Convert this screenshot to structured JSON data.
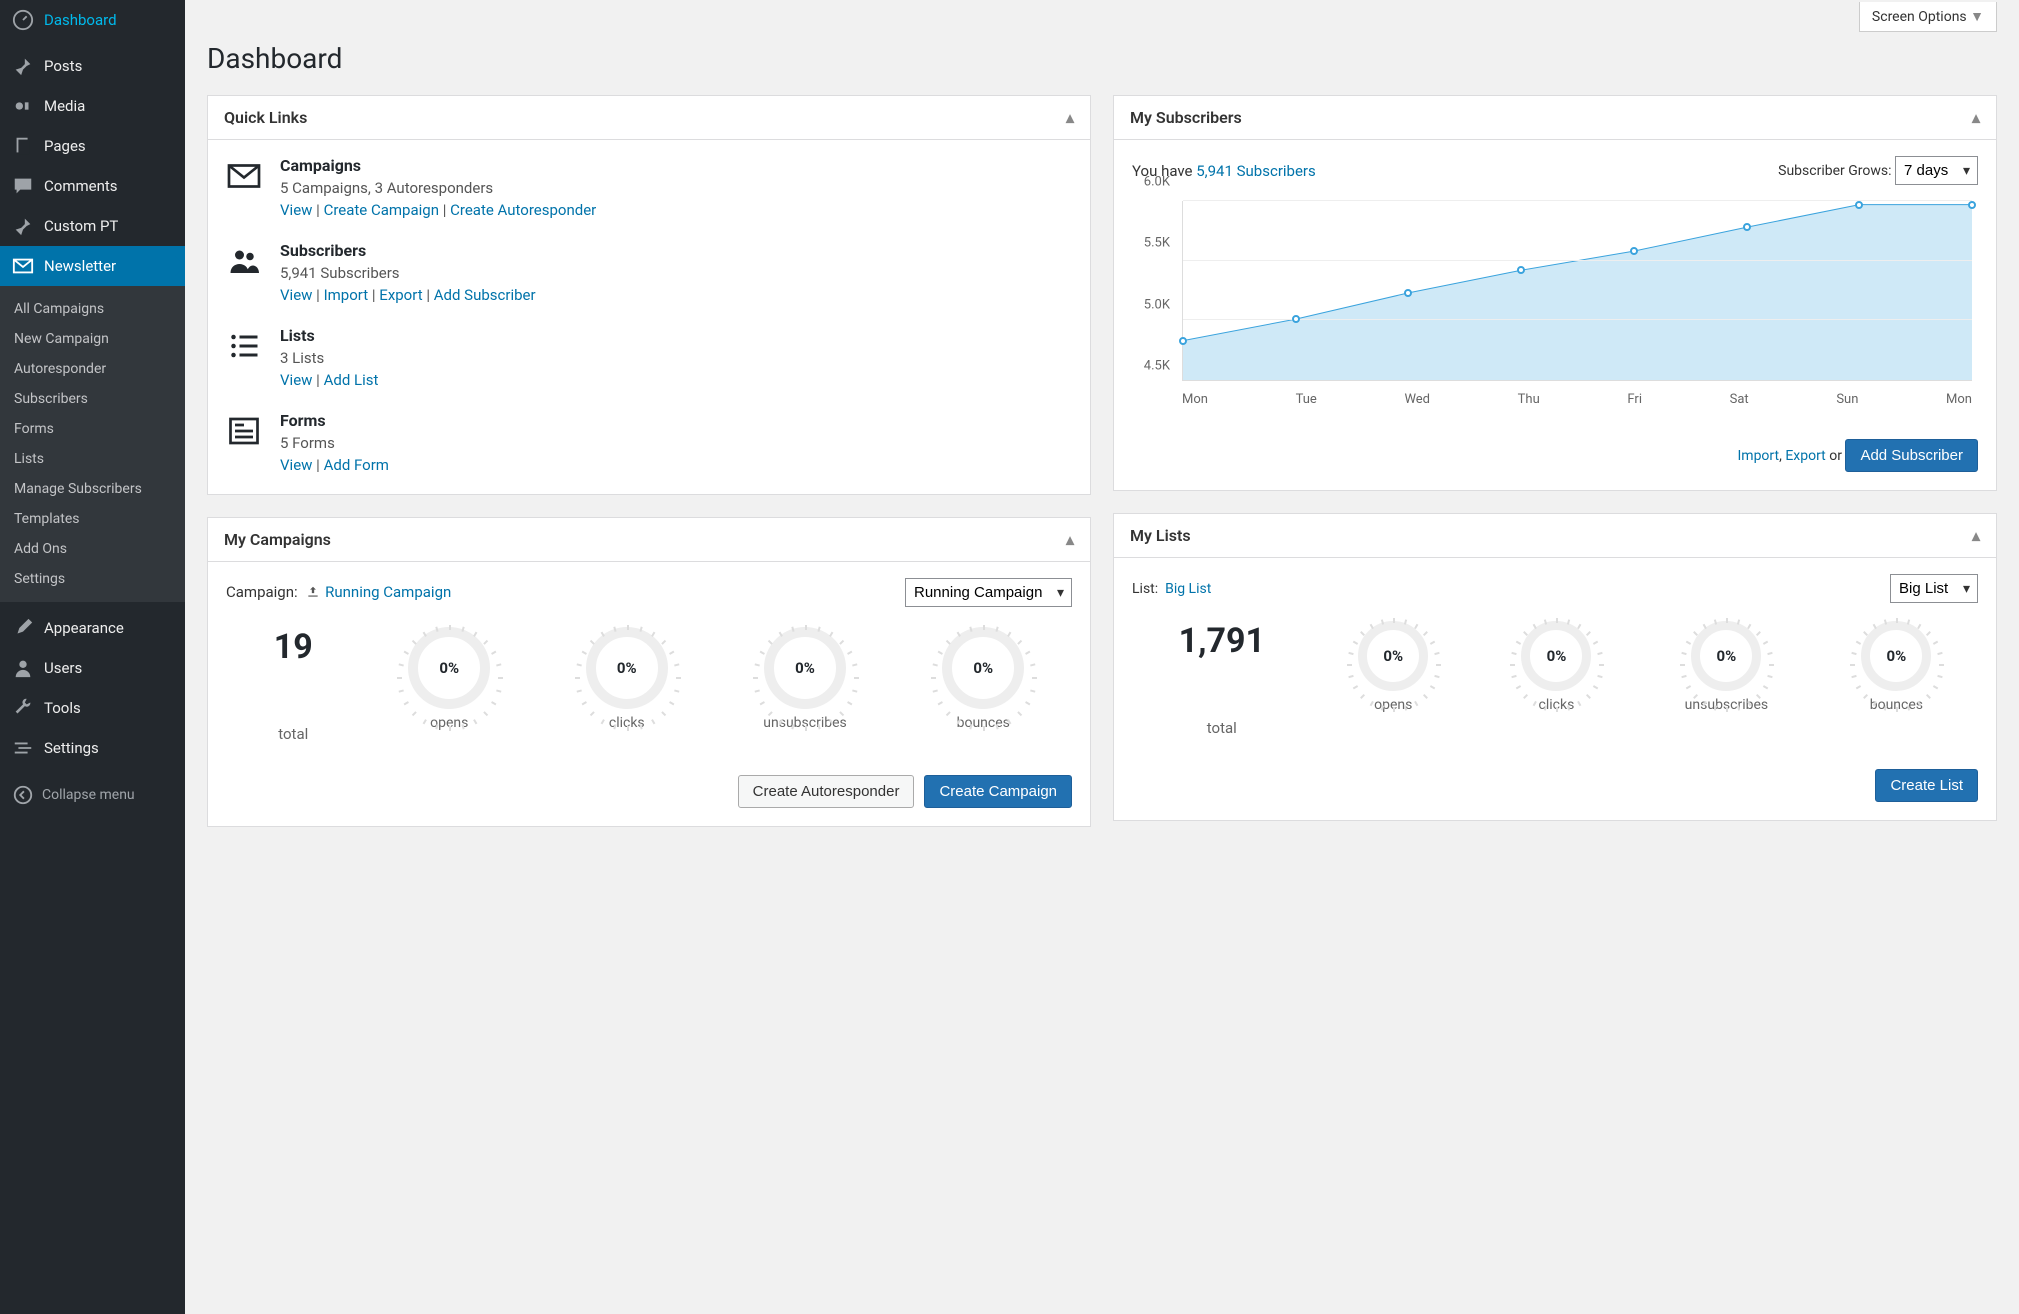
{
  "screen_options": "Screen Options",
  "page_title": "Dashboard",
  "sidebar": {
    "items": [
      {
        "label": "Dashboard",
        "icon": "dashboard"
      },
      {
        "label": "Posts",
        "icon": "pin"
      },
      {
        "label": "Media",
        "icon": "media"
      },
      {
        "label": "Pages",
        "icon": "page"
      },
      {
        "label": "Comments",
        "icon": "comment"
      },
      {
        "label": "Custom PT",
        "icon": "pin"
      },
      {
        "label": "Newsletter",
        "icon": "mail",
        "active": true
      },
      {
        "label": "Appearance",
        "icon": "brush"
      },
      {
        "label": "Users",
        "icon": "user"
      },
      {
        "label": "Tools",
        "icon": "wrench"
      },
      {
        "label": "Settings",
        "icon": "sliders"
      }
    ],
    "submenu": [
      "All Campaigns",
      "New Campaign",
      "Autoresponder",
      "Subscribers",
      "Forms",
      "Lists",
      "Manage Subscribers",
      "Templates",
      "Add Ons",
      "Settings"
    ],
    "collapse": "Collapse menu"
  },
  "quick_links": {
    "title": "Quick Links",
    "sections": [
      {
        "title": "Campaigns",
        "sub": "5 Campaigns, 3 Autoresponders",
        "links": [
          "View",
          "Create Campaign",
          "Create Autoresponder"
        ]
      },
      {
        "title": "Subscribers",
        "sub": "5,941 Subscribers",
        "links": [
          "View",
          "Import",
          "Export",
          "Add Subscriber"
        ]
      },
      {
        "title": "Lists",
        "sub": "3 Lists",
        "links": [
          "View",
          "Add List"
        ]
      },
      {
        "title": "Forms",
        "sub": "5 Forms",
        "links": [
          "View",
          "Add Form"
        ]
      }
    ]
  },
  "campaigns": {
    "title": "My Campaigns",
    "label": "Campaign:",
    "current": "Running Campaign",
    "select": "Running Campaign",
    "total": "19",
    "total_label": "total",
    "gauges": [
      {
        "val": "0%",
        "label": "opens"
      },
      {
        "val": "0%",
        "label": "clicks"
      },
      {
        "val": "0%",
        "label": "unsubscribes"
      },
      {
        "val": "0%",
        "label": "bounces"
      }
    ],
    "btn_secondary": "Create Autoresponder",
    "btn_primary": "Create Campaign"
  },
  "subscribers": {
    "title": "My Subscribers",
    "have_pre": "You have ",
    "have_link": "5,941 Subscribers",
    "grow_label": "Subscriber Grows:",
    "grow_select": "7 days",
    "import": "Import",
    "export": "Export",
    "or": " or ",
    "add_btn": "Add Subscriber"
  },
  "chart_data": {
    "type": "line",
    "categories": [
      "Mon",
      "Tue",
      "Wed",
      "Thu",
      "Fri",
      "Sat",
      "Sun",
      "Mon"
    ],
    "values": [
      4830,
      5010,
      5230,
      5420,
      5580,
      5780,
      5970,
      5970
    ],
    "ylabel": "",
    "xlabel": "",
    "ylim": [
      4500,
      6000
    ],
    "yticks": [
      "4.5K",
      "5.0K",
      "5.5K",
      "6.0K"
    ]
  },
  "lists": {
    "title": "My Lists",
    "label": "List:",
    "current": "Big List",
    "select": "Big List",
    "total": "1,791",
    "total_label": "total",
    "gauges": [
      {
        "val": "0%",
        "label": "opens"
      },
      {
        "val": "0%",
        "label": "clicks"
      },
      {
        "val": "0%",
        "label": "unsubscribes"
      },
      {
        "val": "0%",
        "label": "bounces"
      }
    ],
    "btn": "Create List"
  }
}
